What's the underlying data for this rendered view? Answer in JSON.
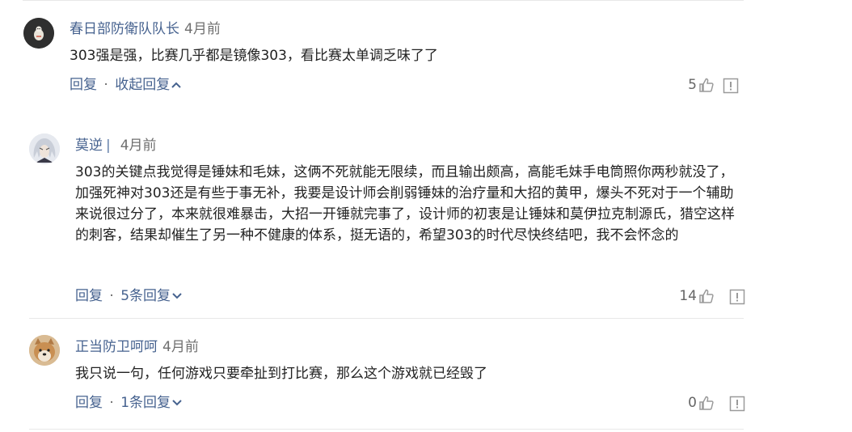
{
  "comments": [
    {
      "author": "春日部防衛队队长",
      "author_suffix": "",
      "time": "4月前",
      "text": "303强是强，比赛几乎都是镜像303，看比赛太单调乏味了了",
      "reply_label": "回复",
      "replies_label": "收起回复",
      "replies_chevron": "chevron-up-icon",
      "likes": "5"
    },
    {
      "author": "莫逆",
      "author_suffix": "|",
      "time": "4月前",
      "text": "303的关键点我觉得是锤妹和毛妹，这俩不死就能无限续，而且输出颇高，高能毛妹手电筒照你两秒就没了，加强死神对303还是有些于事无补，我要是设计师会削弱锤妹的治疗量和大招的黄甲，爆头不死对于一个辅助来说很过分了，本来就很难暴击，大招一开锤就完事了，设计师的初衷是让锤妹和莫伊拉克制源氏，猎空这样的刺客，结果却催生了另一种不健康的体系，挺无语的，希望303的时代尽快终结吧，我不会怀念的",
      "reply_label": "回复",
      "replies_label": "5条回复",
      "replies_chevron": "chevron-down-icon",
      "likes": "14"
    },
    {
      "author": "正当防卫呵呵",
      "author_suffix": "",
      "time": "4月前",
      "text": "我只说一句，任何游戏只要牵扯到打比赛，那么这个游戏就已经毁了",
      "reply_label": "回复",
      "replies_label": "1条回复",
      "replies_chevron": "chevron-down-icon",
      "likes": "0"
    }
  ],
  "separator": "·",
  "colors": {
    "link": "#46628f",
    "text": "#222222",
    "muted": "#666666",
    "divider": "#e8e8e8"
  }
}
